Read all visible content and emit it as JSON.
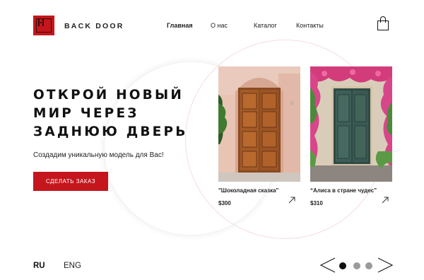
{
  "header": {
    "brand": "BACK DOOR",
    "nav": [
      "Главная",
      "О нас",
      "Каталог",
      "Контакты"
    ],
    "active_nav": "Главная",
    "cart_icon": "shopping-bag-icon"
  },
  "hero": {
    "title_lines": [
      "ОТКРОЙ НОВЫЙ",
      "МИР ЧЕРЕЗ",
      "ЗАДНЮЮ ДВЕРЬ"
    ],
    "subtitle": "Создадим уникальную модель для Вас!",
    "cta_label": "СДЕЛАТЬ ЗАКАЗ"
  },
  "products": [
    {
      "title": "\"Шоколадная сказка\"",
      "price": "$300",
      "image": "wooden-door-photo"
    },
    {
      "title": "“Алиса в стране чудес”",
      "price": "$310",
      "image": "green-door-with-flowers-photo"
    }
  ],
  "footer": {
    "languages": [
      "RU",
      "ENG"
    ],
    "active_language": "RU",
    "pager_total": 3,
    "pager_current": 1
  },
  "colors": {
    "accent": "#c4161c",
    "text": "#111111",
    "dot_inactive": "#9a9a9a"
  }
}
